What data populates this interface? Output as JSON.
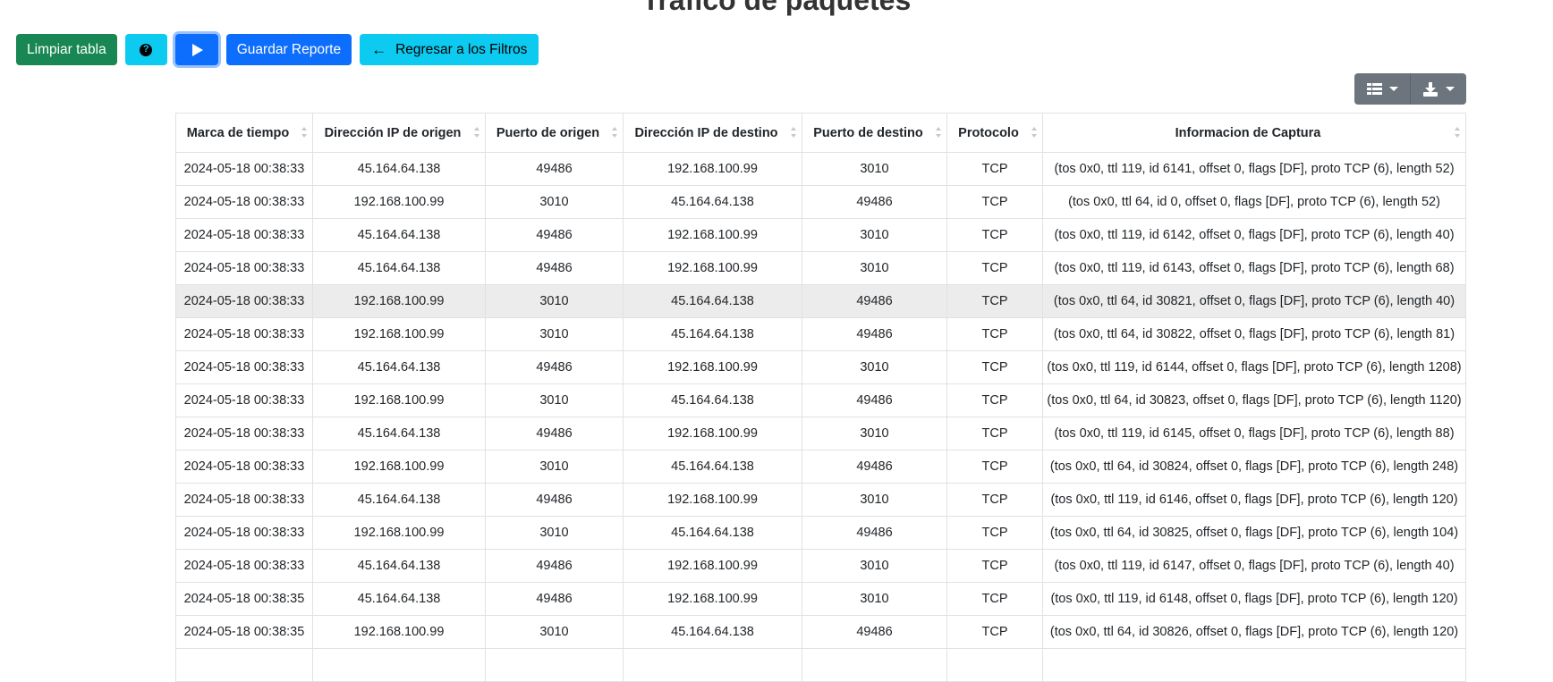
{
  "page": {
    "title": "Tráfico de paquetes"
  },
  "toolbar": {
    "clear_label": "Limpiar tabla",
    "help_icon": "question-circle-icon",
    "play_icon": "play-icon",
    "save_label": "Guardar Reporte",
    "back_label": "Regresar a los Filtros",
    "back_icon": "arrow-left-icon"
  },
  "colors": {
    "green": "#198754",
    "cyan": "#0dcaf0",
    "blue": "#0d6efd",
    "gray": "#6c757d",
    "row_hover": "#ececec"
  },
  "table_tools": {
    "columns_icon": "table-columns-icon",
    "export_icon": "download-icon"
  },
  "table": {
    "columns": [
      "Marca de tiempo",
      "Dirección IP de origen",
      "Puerto de origen",
      "Dirección IP de destino",
      "Puerto de destino",
      "Protocolo",
      "Informacion de Captura"
    ],
    "rows": [
      [
        "2024-05-18 00:38:33",
        "45.164.64.138",
        "49486",
        "192.168.100.99",
        "3010",
        "TCP",
        "(tos 0x0, ttl 119, id 6141, offset 0, flags [DF], proto TCP (6), length 52)"
      ],
      [
        "2024-05-18 00:38:33",
        "192.168.100.99",
        "3010",
        "45.164.64.138",
        "49486",
        "TCP",
        "(tos 0x0, ttl 64, id 0, offset 0, flags [DF], proto TCP (6), length 52)"
      ],
      [
        "2024-05-18 00:38:33",
        "45.164.64.138",
        "49486",
        "192.168.100.99",
        "3010",
        "TCP",
        "(tos 0x0, ttl 119, id 6142, offset 0, flags [DF], proto TCP (6), length 40)"
      ],
      [
        "2024-05-18 00:38:33",
        "45.164.64.138",
        "49486",
        "192.168.100.99",
        "3010",
        "TCP",
        "(tos 0x0, ttl 119, id 6143, offset 0, flags [DF], proto TCP (6), length 68)"
      ],
      [
        "2024-05-18 00:38:33",
        "192.168.100.99",
        "3010",
        "45.164.64.138",
        "49486",
        "TCP",
        "(tos 0x0, ttl 64, id 30821, offset 0, flags [DF], proto TCP (6), length 40)"
      ],
      [
        "2024-05-18 00:38:33",
        "192.168.100.99",
        "3010",
        "45.164.64.138",
        "49486",
        "TCP",
        "(tos 0x0, ttl 64, id 30822, offset 0, flags [DF], proto TCP (6), length 81)"
      ],
      [
        "2024-05-18 00:38:33",
        "45.164.64.138",
        "49486",
        "192.168.100.99",
        "3010",
        "TCP",
        "(tos 0x0, ttl 119, id 6144, offset 0, flags [DF], proto TCP (6), length 1208)"
      ],
      [
        "2024-05-18 00:38:33",
        "192.168.100.99",
        "3010",
        "45.164.64.138",
        "49486",
        "TCP",
        "(tos 0x0, ttl 64, id 30823, offset 0, flags [DF], proto TCP (6), length 1120)"
      ],
      [
        "2024-05-18 00:38:33",
        "45.164.64.138",
        "49486",
        "192.168.100.99",
        "3010",
        "TCP",
        "(tos 0x0, ttl 119, id 6145, offset 0, flags [DF], proto TCP (6), length 88)"
      ],
      [
        "2024-05-18 00:38:33",
        "192.168.100.99",
        "3010",
        "45.164.64.138",
        "49486",
        "TCP",
        "(tos 0x0, ttl 64, id 30824, offset 0, flags [DF], proto TCP (6), length 248)"
      ],
      [
        "2024-05-18 00:38:33",
        "45.164.64.138",
        "49486",
        "192.168.100.99",
        "3010",
        "TCP",
        "(tos 0x0, ttl 119, id 6146, offset 0, flags [DF], proto TCP (6), length 120)"
      ],
      [
        "2024-05-18 00:38:33",
        "192.168.100.99",
        "3010",
        "45.164.64.138",
        "49486",
        "TCP",
        "(tos 0x0, ttl 64, id 30825, offset 0, flags [DF], proto TCP (6), length 104)"
      ],
      [
        "2024-05-18 00:38:33",
        "45.164.64.138",
        "49486",
        "192.168.100.99",
        "3010",
        "TCP",
        "(tos 0x0, ttl 119, id 6147, offset 0, flags [DF], proto TCP (6), length 40)"
      ],
      [
        "2024-05-18 00:38:35",
        "45.164.64.138",
        "49486",
        "192.168.100.99",
        "3010",
        "TCP",
        "(tos 0x0, ttl 119, id 6148, offset 0, flags [DF], proto TCP (6), length 120)"
      ],
      [
        "2024-05-18 00:38:35",
        "192.168.100.99",
        "3010",
        "45.164.64.138",
        "49486",
        "TCP",
        "(tos 0x0, ttl 64, id 30826, offset 0, flags [DF], proto TCP (6), length 120)"
      ],
      [
        "",
        "",
        "",
        "",
        "",
        "",
        ""
      ]
    ],
    "hovered_row": 4
  }
}
